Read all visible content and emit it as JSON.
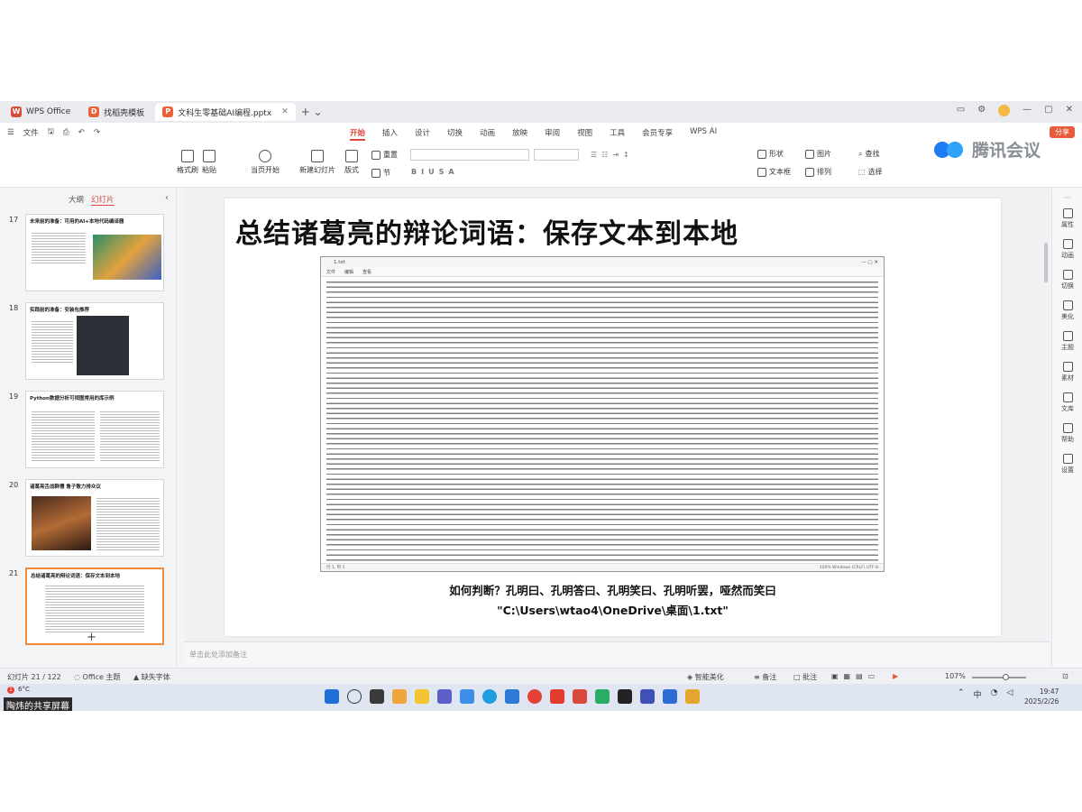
{
  "tabs": [
    {
      "label": "WPS Office",
      "color": "#d9483b",
      "glyph": "W"
    },
    {
      "label": "找稻壳模板",
      "color": "#e8613a",
      "glyph": "D"
    },
    {
      "label": "文科生零基础AI编程.pptx",
      "color": "#e8613a",
      "glyph": "P",
      "active": true
    }
  ],
  "menu": {
    "file_label": "文件",
    "tabs": [
      "开始",
      "插入",
      "设计",
      "切换",
      "动画",
      "放映",
      "审阅",
      "视图",
      "工具",
      "会员专享",
      "WPS AI"
    ],
    "active_tab": "开始",
    "share_label": "分享"
  },
  "ribbon": {
    "format_painter": "格式刷",
    "paste": "粘贴",
    "start_from_current": "当页开始",
    "new_slide": "新建幻灯片",
    "layout": "版式",
    "section": "节",
    "reset": "重置",
    "shape": "形状",
    "picture": "图片",
    "textbox": "文本框",
    "arrange": "排列",
    "find": "查找",
    "select": "选择"
  },
  "watermark": {
    "text": "腾讯会议"
  },
  "left_panel": {
    "tab_outline": "大纲",
    "tab_slides": "幻灯片",
    "slides": [
      {
        "num": "17",
        "title": "未来前的准备：可用的AI+本地代码编译器"
      },
      {
        "num": "18",
        "title": "实践前的准备：安装包推荐"
      },
      {
        "num": "19",
        "title": "Python数据分析可视图常用的库示例"
      },
      {
        "num": "20",
        "title": "诸葛亮舌战群儒 鲁子敬力排众议"
      },
      {
        "num": "21",
        "title": "总结诸葛亮的辩论词语：保存文本到本地",
        "active": true
      }
    ]
  },
  "slide": {
    "title": "总结诸葛亮的辩论词语：保存文本到本地",
    "caption1": "如何判断？孔明曰、孔明答曰、孔明笑曰、孔明听罢，哑然而笑曰",
    "caption2": "\"C:\\Users\\wtao4\\OneDrive\\桌面\\1.txt\"",
    "notepad": {
      "title": "1.txt",
      "menu": [
        "文件",
        "编辑",
        "查看"
      ],
      "status_left": "行 1, 列 1",
      "status_right": "100%    Windows (CRLF)    UTF-8"
    }
  },
  "notes_placeholder": "单击此处添加备注",
  "right_sidebar": [
    "属性",
    "动画",
    "切换",
    "美化",
    "主题",
    "素材",
    "文库",
    "帮助",
    "设置"
  ],
  "statusbar": {
    "slide_count": "幻灯片 21 / 122",
    "theme": "Office 主题",
    "missing_font": "缺失字体",
    "smart_beautify": "智能美化",
    "notes": "备注",
    "comments": "批注",
    "zoom": "107%"
  },
  "taskbar": {
    "temperature": "6°C",
    "share_banner": "陶炜的共享屏幕",
    "time": "19:47",
    "date": "2025/2/26",
    "ime": "中"
  },
  "colors": {
    "accent": "#d9483b",
    "active_thumb": "#f08a3c",
    "meeting_blue": "#1f7cf2"
  }
}
